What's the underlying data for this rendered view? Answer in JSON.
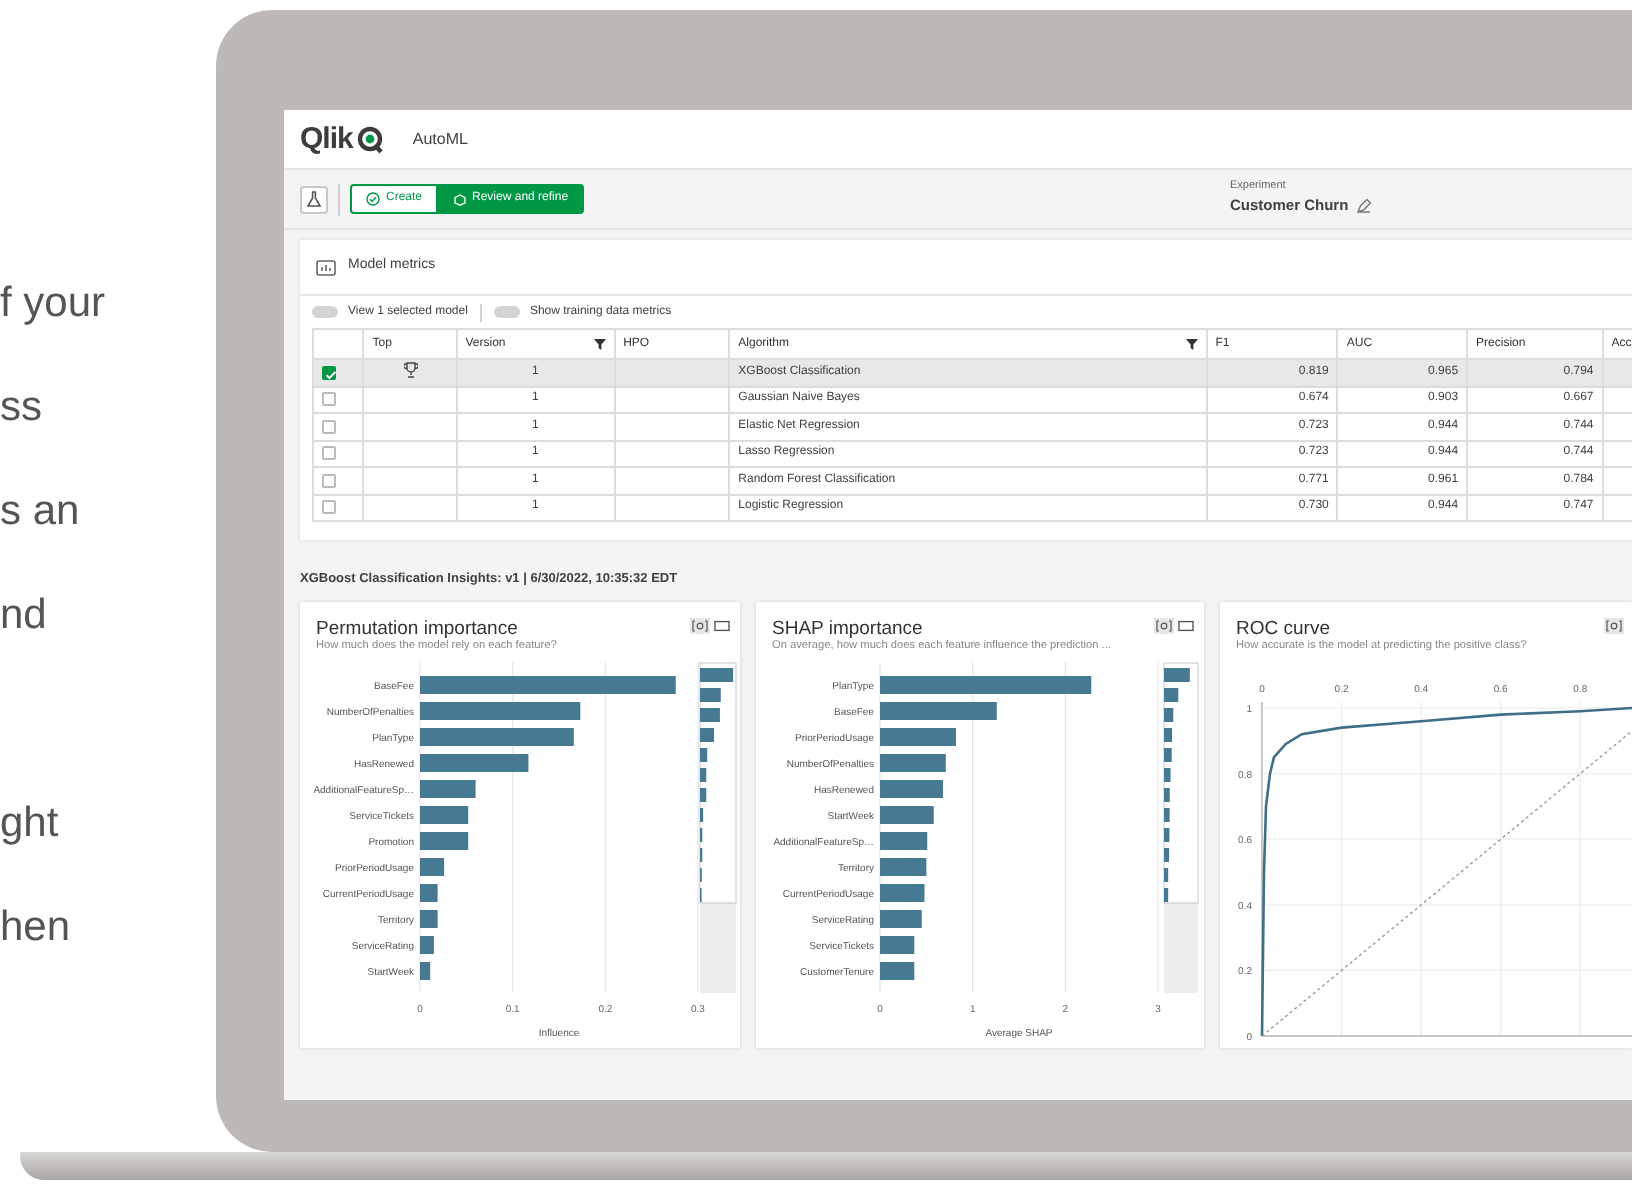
{
  "side_text": {
    "lines": [
      "f your",
      "ss",
      "s an",
      "nd",
      "ght",
      "hen"
    ]
  },
  "app": {
    "logo": "Qlik",
    "title": "AutoML"
  },
  "steps": [
    {
      "label": "Create",
      "selected": false
    },
    {
      "label": "Review and refine",
      "selected": true
    }
  ],
  "experiment": {
    "label": "Experiment",
    "name": "Customer Churn"
  },
  "model_metrics": {
    "title": "Model metrics",
    "toggles": [
      {
        "label": "View 1 selected model",
        "on": false
      },
      {
        "label": "Show training data metrics",
        "on": false
      }
    ],
    "columns": [
      {
        "label": "Top",
        "filter": false
      },
      {
        "label": "Version",
        "filter": true
      },
      {
        "label": "HPO",
        "filter": false
      },
      {
        "label": "Algorithm",
        "filter": true
      },
      {
        "label": "F1",
        "filter": false
      },
      {
        "label": "AUC",
        "filter": false
      },
      {
        "label": "Precision",
        "filter": false
      },
      {
        "label": "Acc",
        "filter": false
      }
    ],
    "rows": [
      {
        "checked": true,
        "selected": true,
        "top": true,
        "cells": [
          null,
          "1",
          null,
          "XGBoost Classification",
          "0.819",
          "0.965",
          "0.794"
        ]
      },
      {
        "checked": false,
        "selected": false,
        "top": false,
        "cells": [
          null,
          "1",
          null,
          "Gaussian Naive Bayes",
          "0.674",
          "0.903",
          "0.667"
        ]
      },
      {
        "checked": false,
        "selected": false,
        "top": false,
        "cells": [
          null,
          "1",
          null,
          "Elastic Net Regression",
          "0.723",
          "0.944",
          "0.744"
        ]
      },
      {
        "checked": false,
        "selected": false,
        "top": false,
        "cells": [
          null,
          "1",
          null,
          "Lasso Regression",
          "0.723",
          "0.944",
          "0.744"
        ]
      },
      {
        "checked": false,
        "selected": false,
        "top": false,
        "cells": [
          null,
          "1",
          null,
          "Random Forest Classification",
          "0.771",
          "0.961",
          "0.784"
        ]
      },
      {
        "checked": false,
        "selected": false,
        "top": false,
        "cells": [
          null,
          "1",
          null,
          "Logistic Regression",
          "0.730",
          "0.944",
          "0.747"
        ]
      }
    ]
  },
  "insights_title": "XGBoost Classification Insights: v1 | 6/30/2022, 10:35:32 EDT",
  "charts": [
    {
      "title": "Permutation importance",
      "subtitle": "How much does the model rely on each feature?",
      "chart_data": {
        "type": "bar",
        "orientation": "horizontal",
        "xlabel": "Influence",
        "grid": true,
        "categories": [
          "BaseFee",
          "NumberOfPenalties",
          "PlanType",
          "HasRenewed",
          "AdditionalFeatureSp…",
          "ServiceTickets",
          "Promotion",
          "PriorPeriodUsage",
          "CurrentPeriodUsage",
          "Territory",
          "ServiceRating",
          "StartWeek"
        ],
        "values": [
          0.276,
          0.173,
          0.166,
          0.117,
          0.06,
          0.052,
          0.052,
          0.026,
          0.019,
          0.019,
          0.015,
          0.011
        ],
        "xlim": [
          0,
          0.3
        ],
        "xticks": [
          0,
          0.1,
          0.2,
          0.3
        ]
      }
    },
    {
      "title": "SHAP importance",
      "subtitle": "On average, how much does each feature influence the prediction ...",
      "chart_data": {
        "type": "bar",
        "orientation": "horizontal",
        "xlabel": "Average SHAP",
        "grid": true,
        "categories": [
          "PlanType",
          "BaseFee",
          "PriorPeriodUsage",
          "NumberOfPenalties",
          "HasRenewed",
          "StartWeek",
          "AdditionalFeatureSp…",
          "Territory",
          "CurrentPeriodUsage",
          "ServiceRating",
          "ServiceTickets",
          "CustomerTenure"
        ],
        "values": [
          2.28,
          1.26,
          0.82,
          0.71,
          0.68,
          0.58,
          0.51,
          0.5,
          0.48,
          0.45,
          0.37,
          0.37
        ],
        "xlim": [
          0,
          3
        ],
        "xticks": [
          0,
          1,
          2,
          3
        ]
      }
    },
    {
      "title": "ROC curve",
      "subtitle": "How accurate is the model at predicting the positive class?",
      "chart_data": {
        "type": "line",
        "grid": true,
        "x": [
          0,
          0.005,
          0.01,
          0.02,
          0.03,
          0.06,
          0.1,
          0.2,
          0.4,
          0.6,
          0.8,
          0.93
        ],
        "series": [
          {
            "color": "#3f6f87",
            "line_style": "solid",
            "values": [
              0,
              0.5,
              0.7,
              0.8,
              0.85,
              0.89,
              0.92,
              0.94,
              0.96,
              0.98,
              0.99,
              1
            ]
          },
          {
            "color": "#9a9a9a",
            "line_style": "dashed",
            "values": [
              0,
              0.005,
              0.01,
              0.02,
              0.03,
              0.06,
              0.1,
              0.2,
              0.4,
              0.6,
              0.8,
              0.93
            ]
          }
        ],
        "xlim": [
          0,
          0.93
        ],
        "ylim": [
          0,
          1
        ],
        "xticks": [
          0,
          0.2,
          0.4,
          0.6,
          0.8
        ],
        "yticks": [
          0,
          0.2,
          0.4,
          0.6,
          0.8,
          1
        ]
      }
    }
  ]
}
